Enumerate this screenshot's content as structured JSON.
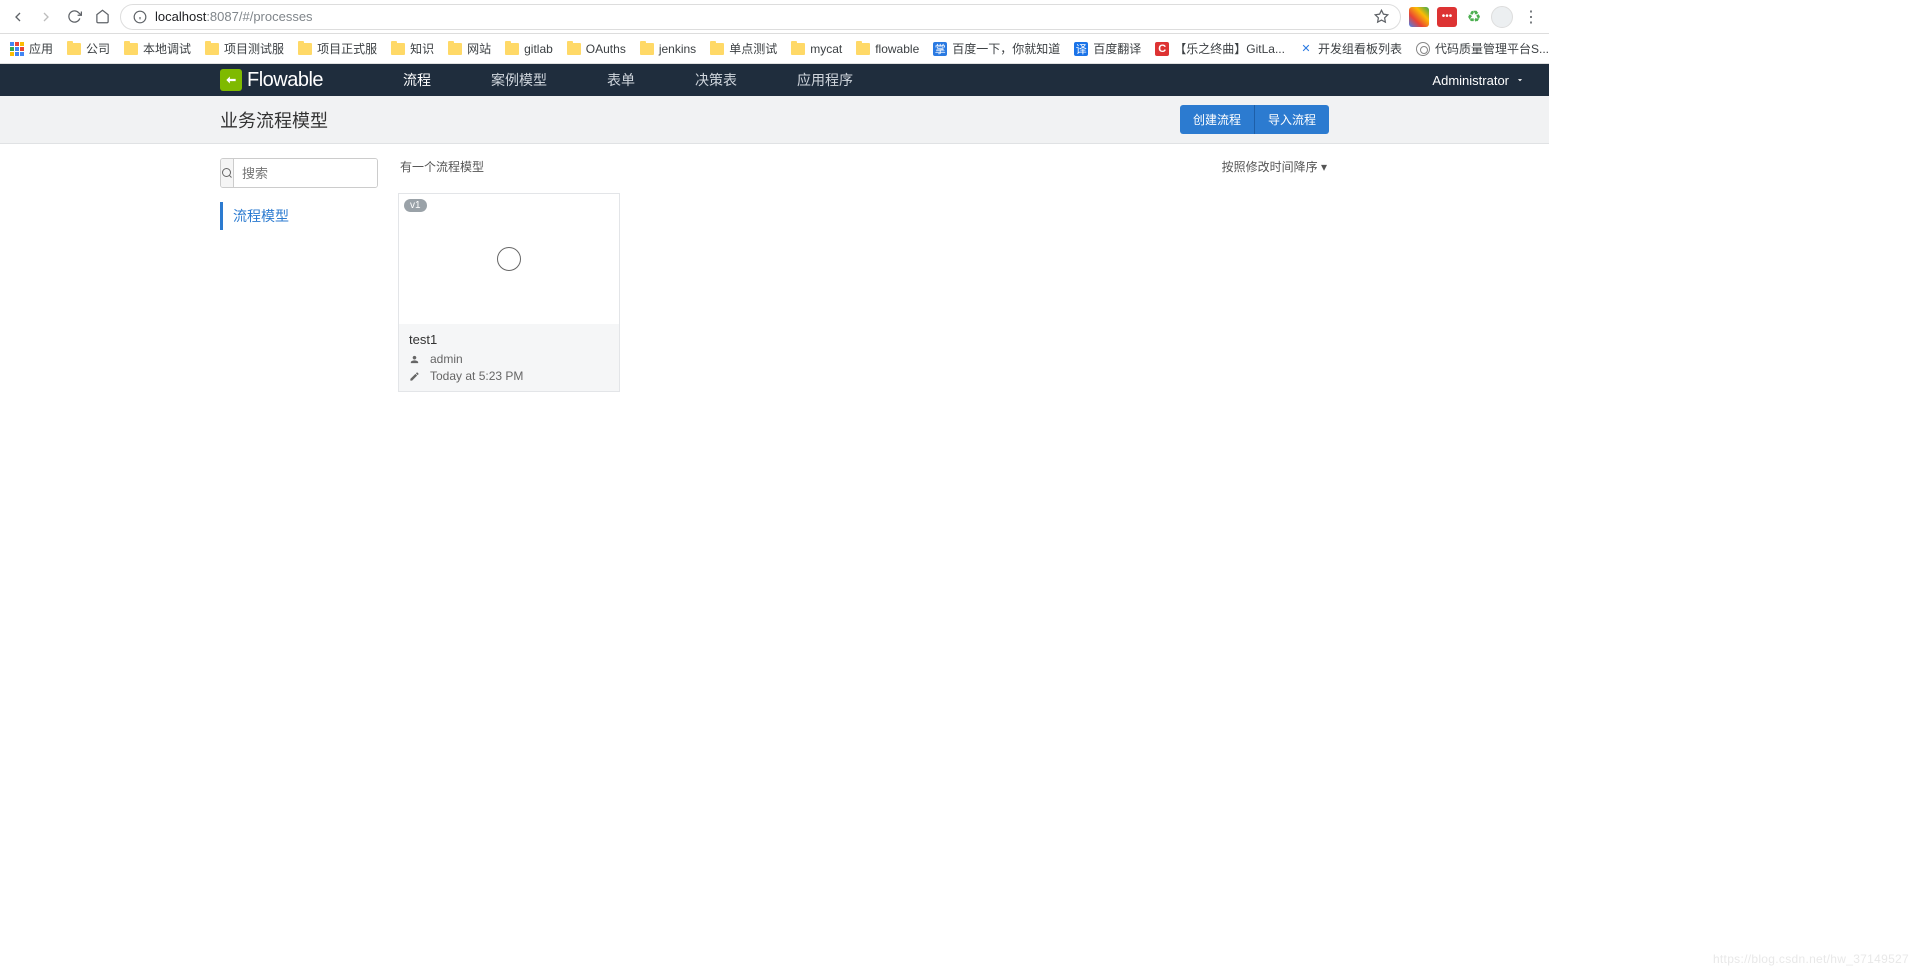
{
  "browser": {
    "url_host": "localhost",
    "url_port": ":8087",
    "url_path": "/#/processes"
  },
  "bookmarks": [
    {
      "label": "应用",
      "type": "apps"
    },
    {
      "label": "公司",
      "type": "folder"
    },
    {
      "label": "本地调试",
      "type": "folder"
    },
    {
      "label": "项目测试服",
      "type": "folder"
    },
    {
      "label": "项目正式服",
      "type": "folder"
    },
    {
      "label": "知识",
      "type": "folder"
    },
    {
      "label": "网站",
      "type": "folder"
    },
    {
      "label": "gitlab",
      "type": "folder"
    },
    {
      "label": "OAuths",
      "type": "folder"
    },
    {
      "label": "jenkins",
      "type": "folder"
    },
    {
      "label": "单点测试",
      "type": "folder"
    },
    {
      "label": "mycat",
      "type": "folder"
    },
    {
      "label": "flowable",
      "type": "folder"
    },
    {
      "label": "百度一下，你就知道",
      "type": "baidu"
    },
    {
      "label": "百度翻译",
      "type": "trans"
    },
    {
      "label": "【乐之终曲】GitLa...",
      "type": "c"
    },
    {
      "label": "开发组看板列表",
      "type": "conf"
    },
    {
      "label": "代码质量管理平台S...",
      "type": "sonar"
    }
  ],
  "app": {
    "logo_text": "Flowable",
    "nav": [
      {
        "label": "流程",
        "active": true
      },
      {
        "label": "案例模型",
        "active": false
      },
      {
        "label": "表单",
        "active": false
      },
      {
        "label": "决策表",
        "active": false
      },
      {
        "label": "应用程序",
        "active": false
      }
    ],
    "user": "Administrator"
  },
  "page": {
    "title": "业务流程模型",
    "create_btn": "创建流程",
    "import_btn": "导入流程",
    "search_placeholder": "搜索",
    "side_link": "流程模型",
    "count_text": "有一个流程模型",
    "sort_label": "按照修改时间降序 ▾"
  },
  "models": [
    {
      "badge": "v1",
      "name": "test1",
      "author": "admin",
      "modified": "Today at 5:23 PM"
    }
  ],
  "watermark": "https://blog.csdn.net/hw_37149527"
}
